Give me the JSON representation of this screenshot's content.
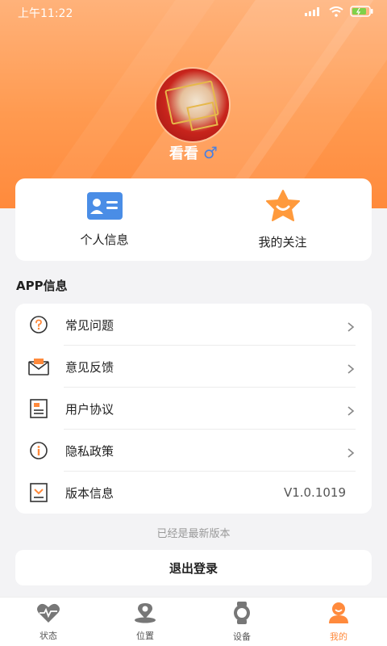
{
  "status_bar": {
    "time": "上午11:22"
  },
  "profile": {
    "name": "看看",
    "gender_symbol": "♂"
  },
  "quick_actions": [
    {
      "label": "个人信息",
      "icon": "id-card-icon"
    },
    {
      "label": "我的关注",
      "icon": "star-icon"
    }
  ],
  "section_title": "APP信息",
  "menu": [
    {
      "label": "常见问题",
      "icon": "question-icon"
    },
    {
      "label": "意见反馈",
      "icon": "envelope-icon"
    },
    {
      "label": "用户协议",
      "icon": "document-icon"
    },
    {
      "label": "隐私政策",
      "icon": "info-shield-icon"
    },
    {
      "label": "版本信息",
      "icon": "download-icon",
      "value": "V1.0.1019"
    }
  ],
  "version_hint": "已经是最新版本",
  "logout_label": "退出登录",
  "tabs": [
    {
      "label": "状态",
      "icon": "heart-pulse-icon",
      "active": false
    },
    {
      "label": "位置",
      "icon": "location-pin-icon",
      "active": false
    },
    {
      "label": "设备",
      "icon": "watch-icon",
      "active": false
    },
    {
      "label": "我的",
      "icon": "user-icon",
      "active": true
    }
  ],
  "colors": {
    "accent": "#ff8a3c",
    "background": "#f3f3f5"
  }
}
